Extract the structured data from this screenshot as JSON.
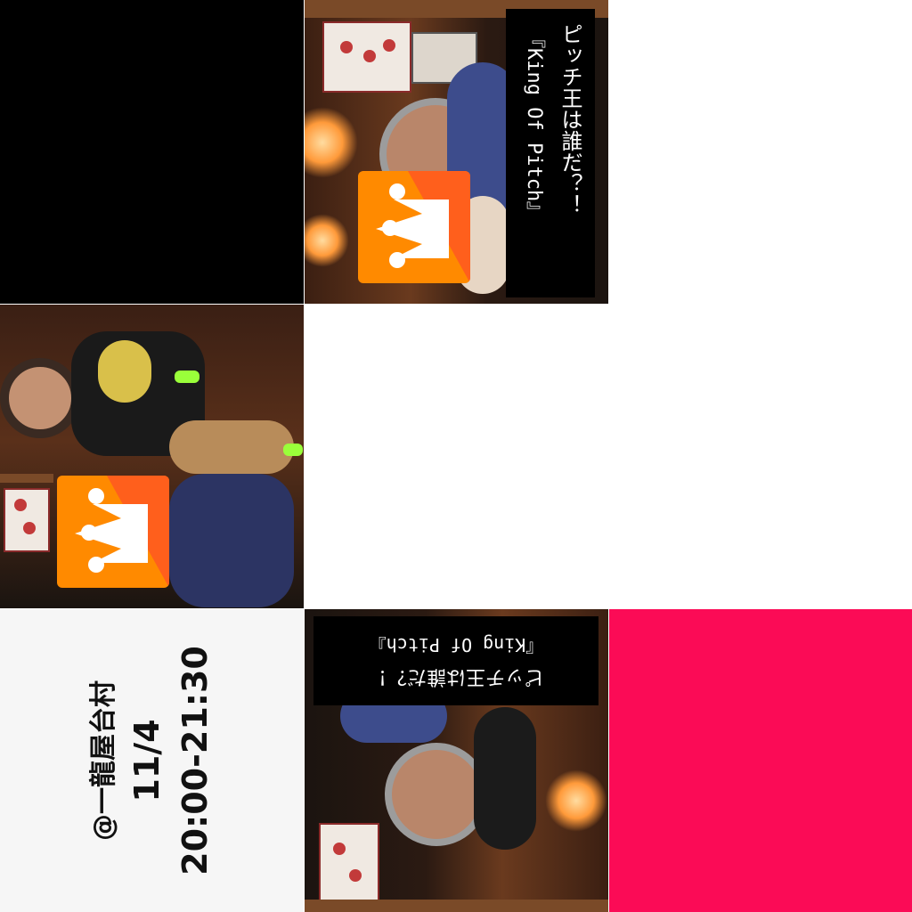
{
  "caption": {
    "line1": "ピッチ王は誰だ？！",
    "line2": "『King Of Pitch』"
  },
  "event": {
    "venue": "@一龍屋台村",
    "date": "11/4",
    "time": "20:00-21:30"
  },
  "colors": {
    "logo_orange": "#ff8a00",
    "logo_shade": "#ff5a1f",
    "accent_pink": "#fb0b56",
    "info_bg": "#f6f6f6"
  },
  "icons": {
    "logo": "crown-logo-icon"
  }
}
